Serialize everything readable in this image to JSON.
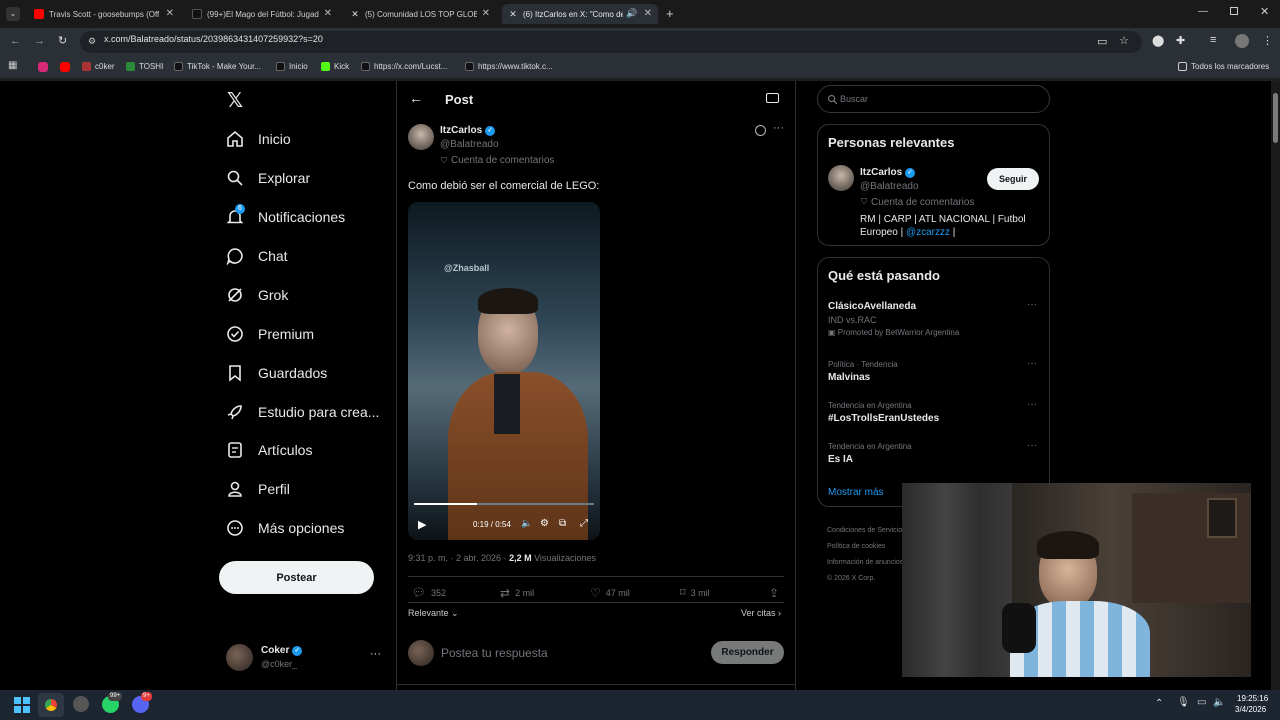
{
  "browser": {
    "tabs": [
      {
        "title": "Travis Scott - goosebumps (Off",
        "favicon_color": "#ff0000"
      },
      {
        "title": "(99+)El Mago del Fútbol: Jugad",
        "favicon_color": "#000000"
      },
      {
        "title": "(5) Comunidad LOS TOP GLOBA",
        "favicon_color": "#000000"
      },
      {
        "title": "(6) ItzCarlos en X: \"Como de",
        "favicon_color": "#000000"
      }
    ],
    "url": "x.com/Balatreado/status/2039863431407259932?s=20",
    "bookmarks": [
      "c0ker",
      "TOSHI",
      "TikTok - Make Your...",
      "Inicio",
      "Kick",
      "https://x.com/Lucst...",
      "https://www.tiktok.c..."
    ],
    "all_bookmarks_label": "Todos los marcadores"
  },
  "nav": {
    "items": [
      "Inicio",
      "Explorar",
      "Notificaciones",
      "Chat",
      "Grok",
      "Premium",
      "Guardados",
      "Estudio para crea...",
      "Artículos",
      "Perfil",
      "Más opciones"
    ],
    "notif_badge": "6",
    "post_button": "Postear",
    "account": {
      "name": "Coker",
      "handle": "@c0ker_"
    }
  },
  "post": {
    "header": "Post",
    "author_name": "ItzCarlos",
    "author_handle": "@Balatreado",
    "label": "Cuenta de comentarios",
    "text": "Como debió ser el comercial de LEGO:",
    "video": {
      "watermark": "@Zhasball",
      "time": "0:19 / 0:54",
      "progress": 0.35
    },
    "timestamp": "9:31 p. m. · 2 abr. 2026 · ",
    "views_count": "2,2 M",
    "views_label": "Visualizaciones",
    "stats": {
      "replies": "352",
      "reposts": "2 mil",
      "likes": "47 mil",
      "bookmarks": "3 mil"
    },
    "sort_label": "Relevante",
    "quotes_label": "Ver citas",
    "reply_placeholder": "Postea tu respuesta",
    "reply_button": "Responder"
  },
  "sidebar": {
    "search_placeholder": "Buscar",
    "relevant": {
      "title": "Personas relevantes",
      "name": "ItzCarlos",
      "handle": "@Balatreado",
      "label": "Cuenta de comentarios",
      "bio": "RM | CARP | ATL NACIONAL | Futbol Europeo | ",
      "bio_link": "@zcarzzz",
      "bio_end": " |",
      "follow": "Seguir"
    },
    "trends_title": "Qué está pasando",
    "trends": [
      {
        "meta": "",
        "title": "ClásicoAvellaneda",
        "sub": "IND vs.RAC",
        "promo": "Promoted by BetWarrior Argentina"
      },
      {
        "meta": "Política · Tendencia",
        "title": "Malvinas"
      },
      {
        "meta": "Tendencia en Argentina",
        "title": "#LosTrollsEranUstedes"
      },
      {
        "meta": "Tendencia en Argentina",
        "title": "Es IA"
      }
    ],
    "show_more": "Mostrar más",
    "footer": [
      "Condiciones de Servicio",
      "Política de cookies",
      "Información de anuncios",
      "© 2026 X Corp."
    ]
  },
  "taskbar": {
    "time": "19:25:16",
    "date": "3/4/2026",
    "whatsapp_badge": "99+",
    "discord_badge": "9+"
  },
  "colors": {
    "accent": "#1d9bf0",
    "bg": "#000000",
    "border": "#2f3336",
    "muted": "#71767b"
  }
}
